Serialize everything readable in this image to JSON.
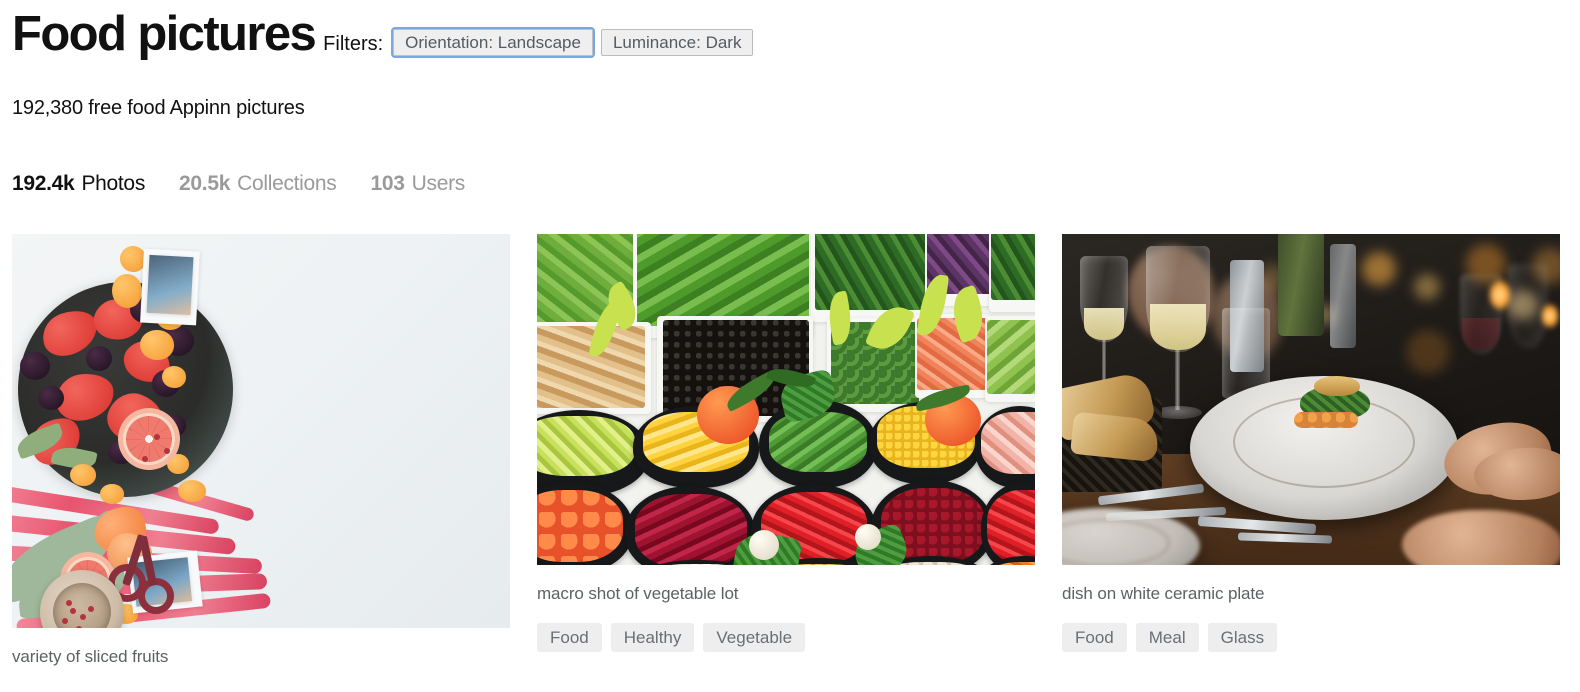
{
  "header": {
    "title": "Food pictures",
    "filters_label": "Filters:",
    "filters": [
      {
        "label": "Orientation: Landscape",
        "focused": true
      },
      {
        "label": "Luminance: Dark",
        "focused": false
      }
    ],
    "subtitle": "192,380 free food Appinn pictures"
  },
  "stats": [
    {
      "num": "192.4k",
      "label": "Photos",
      "active": true
    },
    {
      "num": "20.5k",
      "label": "Collections",
      "active": false
    },
    {
      "num": "103",
      "label": "Users",
      "active": false
    }
  ],
  "columns": [
    {
      "photo_alt": "variety of sliced fruits",
      "caption": "variety of sliced fruits",
      "tags": []
    },
    {
      "photo_alt": "macro shot of vegetable lot",
      "caption": "macro shot of vegetable lot",
      "tags": [
        "Food",
        "Healthy",
        "Vegetable"
      ]
    },
    {
      "photo_alt": "dish on white ceramic plate",
      "caption": "dish on white ceramic plate",
      "tags": [
        "Food",
        "Meal",
        "Glass"
      ]
    }
  ],
  "colors": {
    "text_primary": "#111111",
    "text_muted": "#9a9a9a",
    "caption": "#5d6166",
    "tag_bg": "#eeeeee",
    "tag_text": "#6a6f75",
    "chip_bg": "#efefef",
    "chip_border": "#b9bcbf",
    "focus_ring": "#7aa7e0",
    "page_bg": "#ffffff"
  }
}
